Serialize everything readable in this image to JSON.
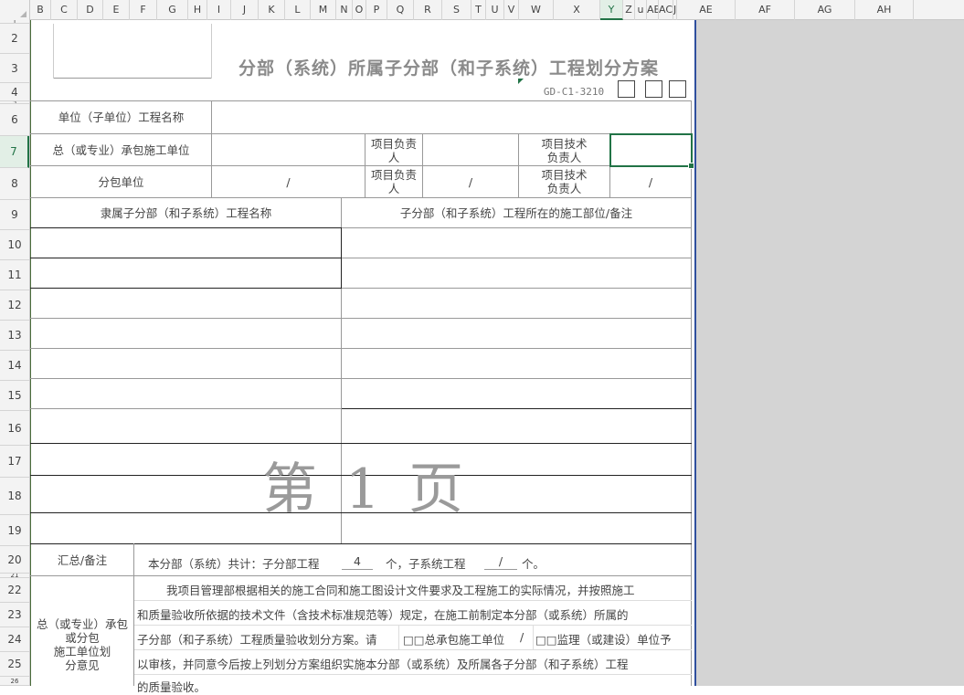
{
  "columns": [
    "B",
    "C",
    "D",
    "E",
    "F",
    "G",
    "H",
    "I",
    "J",
    "K",
    "L",
    "M",
    "N",
    "O",
    "P",
    "Q",
    "R",
    "S",
    "T",
    "U",
    "V",
    "W",
    "X",
    "Y",
    "Z",
    "u",
    "AB",
    "AC",
    "J",
    "AE",
    "AF",
    "AG",
    "AH"
  ],
  "selected_column": "Y",
  "rows": [
    "1",
    "2",
    "3",
    "4",
    "5",
    "6",
    "7",
    "8",
    "9",
    "10",
    "11",
    "12",
    "13",
    "14",
    "15",
    "16",
    "17",
    "18",
    "19",
    "20",
    "21",
    "22",
    "23",
    "24",
    "25",
    "26"
  ],
  "selected_row": "7",
  "form": {
    "title": "分部（系统）所属子分部（和子系统）工程划分方案",
    "code": "GD-C1-3210",
    "unit_name_label": "单位（子单位）工程名称",
    "contractor_label": "总（或专业）承包施工单位",
    "project_lead_label_1": "项目负责",
    "project_lead_label_2": "人",
    "tech_lead_label_1": "项目技术",
    "tech_lead_label_2": "负责人",
    "subcontractor_label": "分包单位",
    "slash": "/",
    "sub_name_header": "隶属子分部（和子系统）工程名称",
    "location_header": "子分部（和子系统）工程所在的施工部位/备注",
    "watermark": "第 1 页",
    "summary_label": "汇总/备注",
    "summary_text_1": "本分部（系统）共计：子分部工程",
    "summary_count": "4",
    "summary_text_2": "个，子系统工程",
    "summary_text_3": "个。",
    "opinion_label_1": "总（或专业）承包",
    "opinion_label_2": "或分包",
    "opinion_label_3": "施工单位划",
    "opinion_label_4": "分意见",
    "opinion_line_1": "我项目管理部根据相关的施工合同和施工图设计文件要求及工程施工的实际情况，并按照施工",
    "opinion_line_2": "和质量验收所依据的技术文件（含技术标准规范等）规定，在施工前制定本分部（或系统）所属的",
    "opinion_line_3a": "子分部（和子系统）工程质量验收划分方案。请",
    "opinion_line_3b": "□□总承包施工单位",
    "opinion_line_3c": "□□监理（或建设）单位予",
    "opinion_line_4": "以审核，并同意今后按上列划分方案组织实施本分部（或系统）及所属各子分部（和子系统）工程",
    "opinion_line_5": "的质量验收。"
  },
  "colors": {
    "selection": "#217346",
    "page_edge": "#2f4f9e",
    "outside": "#d4d4d4"
  }
}
